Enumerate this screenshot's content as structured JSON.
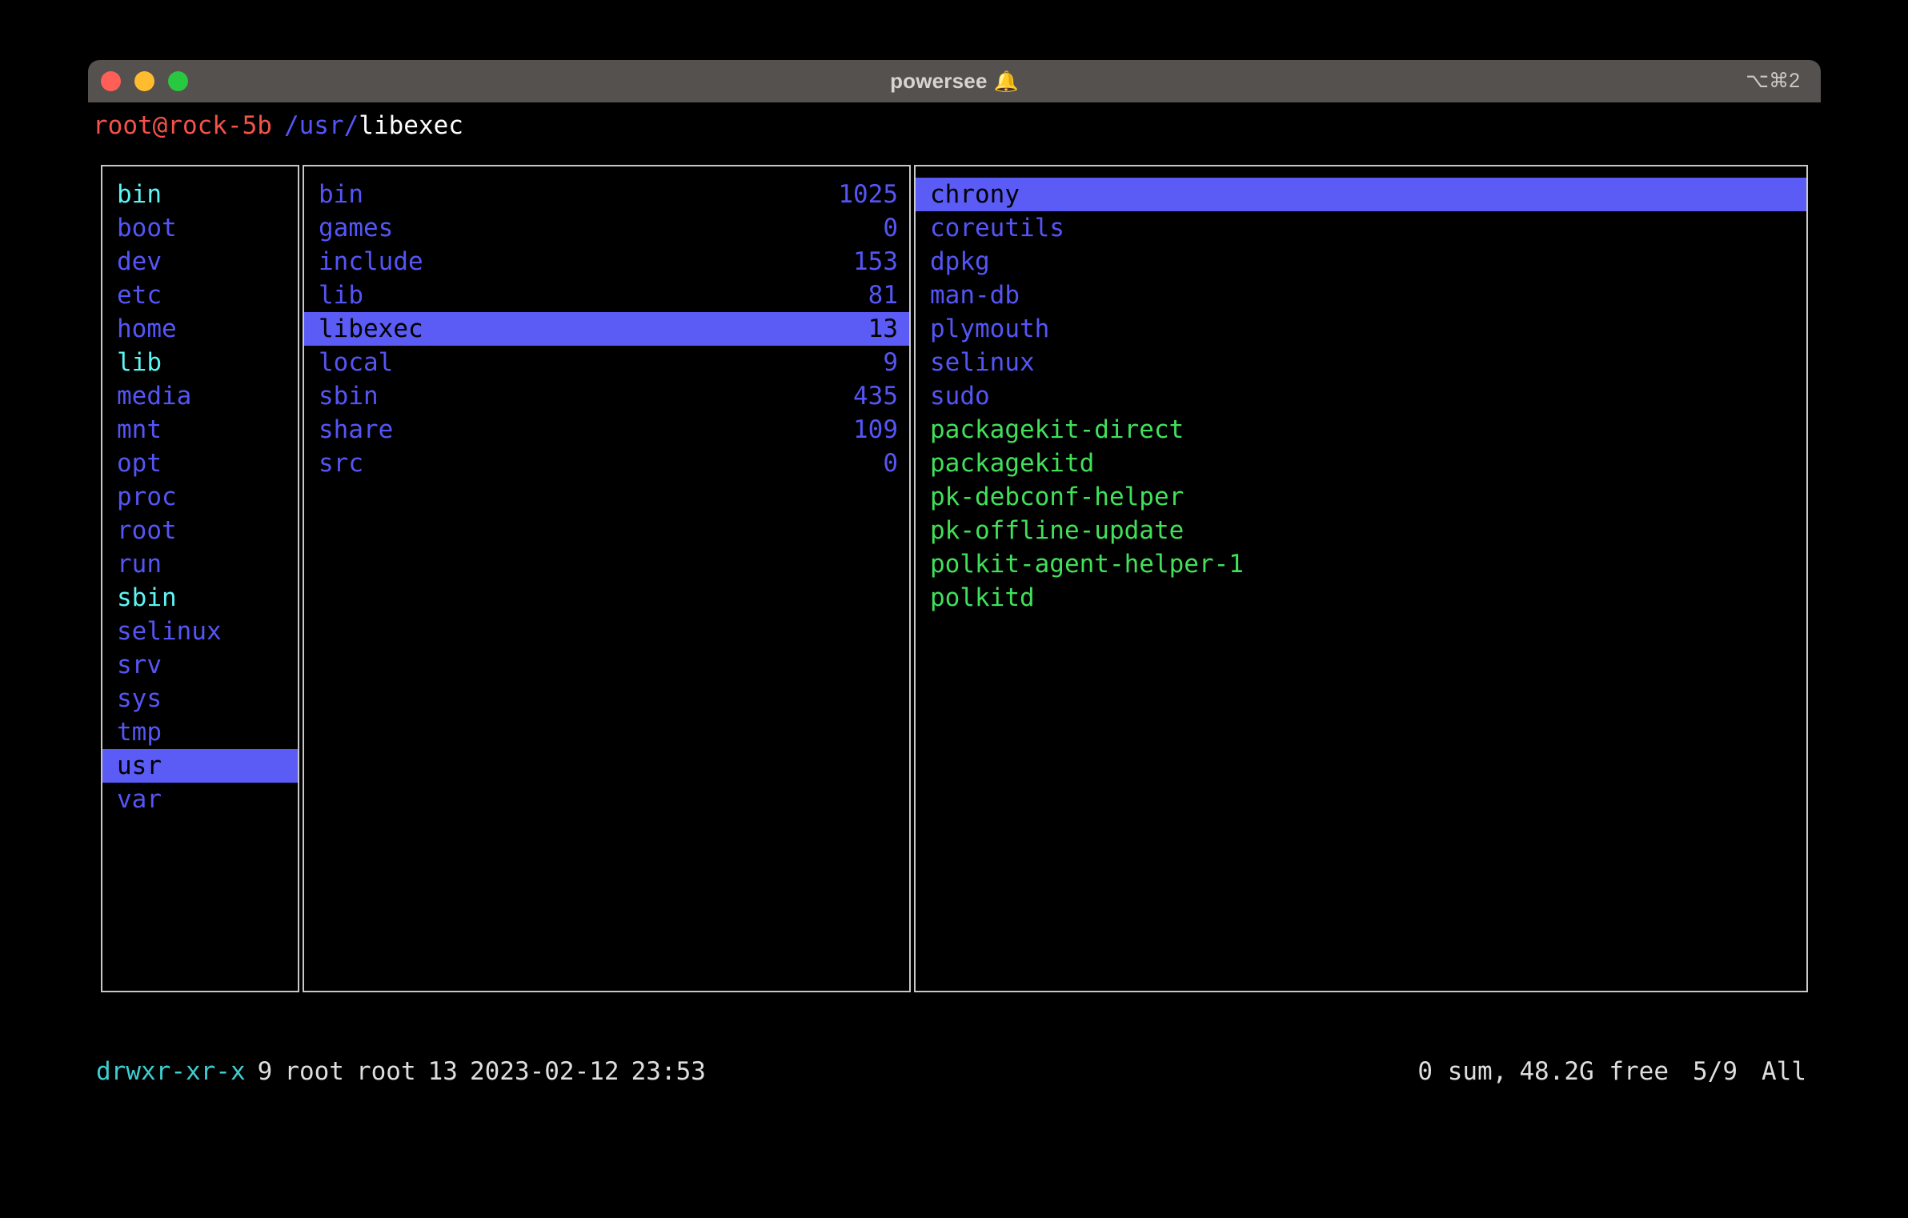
{
  "window": {
    "title": "powersee",
    "title_bell_icon": "bell-emoji",
    "shortcut_badge": "⌥⌘2",
    "traffic_lights": {
      "close_color": "#ff5f57",
      "minimize_color": "#febc2e",
      "maximize_color": "#28c840"
    },
    "titlebar_color": "#55514e"
  },
  "prompt": {
    "user_host": "root@rock-5b",
    "path_prefix": "/usr/",
    "path_leaf": "libexec",
    "user_color": "#f4524a",
    "dir_color": "#5555f7",
    "leaf_color": "#ffffff"
  },
  "colors": {
    "directory": "#5555f7",
    "symlink": "#5ef5f5",
    "executable": "#41e05a",
    "selection_bg": "#5b5bf5",
    "selection_fg": "#000000",
    "panel_border": "#c8c8c8",
    "background": "#000000"
  },
  "panels": {
    "left": {
      "name": "root-directory-column",
      "items": [
        {
          "label": "bin",
          "type": "link",
          "selected": false
        },
        {
          "label": "boot",
          "type": "dir",
          "selected": false
        },
        {
          "label": "dev",
          "type": "dir",
          "selected": false
        },
        {
          "label": "etc",
          "type": "dir",
          "selected": false
        },
        {
          "label": "home",
          "type": "dir",
          "selected": false
        },
        {
          "label": "lib",
          "type": "link",
          "selected": false
        },
        {
          "label": "media",
          "type": "dir",
          "selected": false
        },
        {
          "label": "mnt",
          "type": "dir",
          "selected": false
        },
        {
          "label": "opt",
          "type": "dir",
          "selected": false
        },
        {
          "label": "proc",
          "type": "dir",
          "selected": false
        },
        {
          "label": "root",
          "type": "dir",
          "selected": false
        },
        {
          "label": "run",
          "type": "dir",
          "selected": false
        },
        {
          "label": "sbin",
          "type": "link",
          "selected": false
        },
        {
          "label": "selinux",
          "type": "dir",
          "selected": false
        },
        {
          "label": "srv",
          "type": "dir",
          "selected": false
        },
        {
          "label": "sys",
          "type": "dir",
          "selected": false
        },
        {
          "label": "tmp",
          "type": "dir",
          "selected": false
        },
        {
          "label": "usr",
          "type": "dir",
          "selected": true
        },
        {
          "label": "var",
          "type": "dir",
          "selected": false
        }
      ]
    },
    "middle": {
      "name": "usr-directory-column",
      "items": [
        {
          "label": "bin",
          "size": "1025",
          "type": "dir",
          "selected": false
        },
        {
          "label": "games",
          "size": "0",
          "type": "dir",
          "selected": false
        },
        {
          "label": "include",
          "size": "153",
          "type": "dir",
          "selected": false
        },
        {
          "label": "lib",
          "size": "81",
          "type": "dir",
          "selected": false
        },
        {
          "label": "libexec",
          "size": "13",
          "type": "dir",
          "selected": true
        },
        {
          "label": "local",
          "size": "9",
          "type": "dir",
          "selected": false
        },
        {
          "label": "sbin",
          "size": "435",
          "type": "dir",
          "selected": false
        },
        {
          "label": "share",
          "size": "109",
          "type": "dir",
          "selected": false
        },
        {
          "label": "src",
          "size": "0",
          "type": "dir",
          "selected": false
        }
      ]
    },
    "right": {
      "name": "libexec-contents-column",
      "items": [
        {
          "label": "chrony",
          "type": "dir",
          "selected": true
        },
        {
          "label": "coreutils",
          "type": "dir",
          "selected": false
        },
        {
          "label": "dpkg",
          "type": "dir",
          "selected": false
        },
        {
          "label": "man-db",
          "type": "dir",
          "selected": false
        },
        {
          "label": "plymouth",
          "type": "dir",
          "selected": false
        },
        {
          "label": "selinux",
          "type": "dir",
          "selected": false
        },
        {
          "label": "sudo",
          "type": "dir",
          "selected": false
        },
        {
          "label": "packagekit-direct",
          "type": "exec",
          "selected": false
        },
        {
          "label": "packagekitd",
          "type": "exec",
          "selected": false
        },
        {
          "label": "pk-debconf-helper",
          "type": "exec",
          "selected": false
        },
        {
          "label": "pk-offline-update",
          "type": "exec",
          "selected": false
        },
        {
          "label": "polkit-agent-helper-1",
          "type": "exec",
          "selected": false
        },
        {
          "label": "polkitd",
          "type": "exec",
          "selected": false
        }
      ]
    }
  },
  "statusbar": {
    "permissions": "drwxr-xr-x",
    "links": "9",
    "owner": "root",
    "group": "root",
    "size": "13",
    "date": "2023-02-12",
    "time": "23:53",
    "sum": "0 sum,",
    "free": "48.2G free",
    "position": "5/9",
    "scroll": "All"
  }
}
